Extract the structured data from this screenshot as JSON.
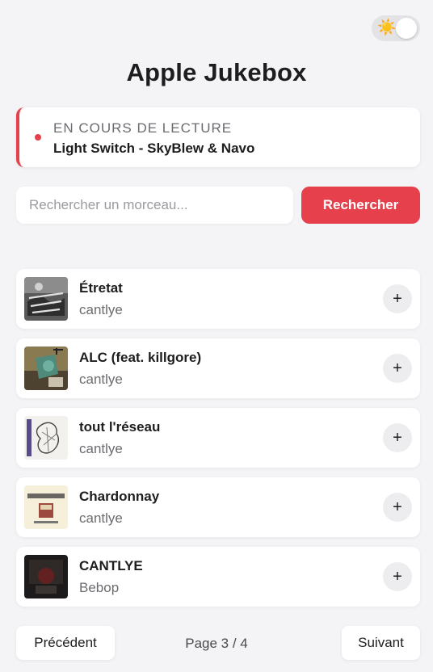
{
  "app": {
    "title": "Apple Jukebox"
  },
  "theme_toggle": {
    "icon": "sun-icon",
    "glyph": "☀️"
  },
  "now_playing": {
    "label": "EN COURS DE LECTURE",
    "track": "Light Switch - SkyBlew & Navo",
    "accent": "#e5404b"
  },
  "search": {
    "placeholder": "Rechercher un morceau...",
    "value": "",
    "button_label": "Rechercher"
  },
  "results": [
    {
      "title": "Étretat",
      "artist": "cantlye",
      "add_label": "+"
    },
    {
      "title": "ALC (feat. killgore)",
      "artist": "cantlye",
      "add_label": "+"
    },
    {
      "title": "tout l'réseau",
      "artist": "cantlye",
      "add_label": "+"
    },
    {
      "title": "Chardonnay",
      "artist": "cantlye",
      "add_label": "+"
    },
    {
      "title": "CANTLYE",
      "artist": "Bebop",
      "add_label": "+"
    }
  ],
  "pagination": {
    "prev_label": "Précédent",
    "page_info": "Page 3 / 4",
    "next_label": "Suivant"
  },
  "colors": {
    "accent": "#e5404b",
    "background": "#f4f4f6"
  }
}
